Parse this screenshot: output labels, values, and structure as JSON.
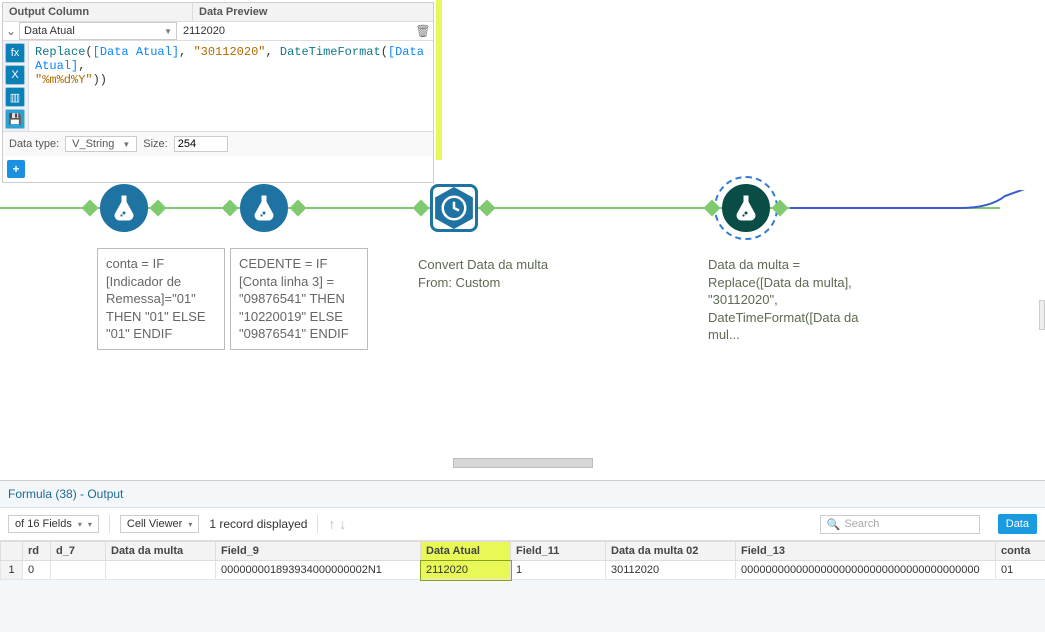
{
  "config": {
    "header_output": "Output Column",
    "header_preview": "Data Preview",
    "output_column": "Data Atual",
    "preview_value": "2112020",
    "formula_parts": {
      "fn1": "Replace",
      "field1": "[Data Atual]",
      "str1": "\"30112020\"",
      "fn2": "DateTimeFormat",
      "field2": "[Data Atual]",
      "str2": "\"%m%d%Y\""
    },
    "dtype_label": "Data type:",
    "dtype_value": "V_String",
    "size_label": "Size:",
    "size_value": "254"
  },
  "annotations": {
    "n1": "conta = IF [Indicador de Remessa]=\"01\" THEN \"01\" ELSE \"01\" ENDIF",
    "n2": "CEDENTE = IF [Conta linha 3] = \"09876541\" THEN \"10220019\" ELSE \"09876541\" ENDIF",
    "n3": "Convert Data da multa From: Custom",
    "n4": "Data da multa = Replace([Data da multa], \"30112020\", DateTimeFormat([Data da mul..."
  },
  "results": {
    "title": "Formula (38) - Output",
    "fields_dd": "of 16 Fields",
    "cellviewer": "Cell Viewer",
    "records": "1 record displayed",
    "search_placeholder": "Search",
    "data_btn": "Data",
    "columns": [
      "rd",
      "d_7",
      "Data da multa",
      "Field_9",
      "Data Atual",
      "Field_11",
      "Data da multa 02",
      "Field_13",
      "conta"
    ],
    "row": {
      "rownum": "1",
      "rd": "0",
      "d_7": "",
      "data_da_multa": "",
      "field_9": "000000001893934000000002N1",
      "data_atual": "2112020",
      "field_11": "1",
      "data_da_multa_02": "30112020",
      "field_13": "000000000000000000000000000000000000000",
      "conta": "01"
    }
  }
}
